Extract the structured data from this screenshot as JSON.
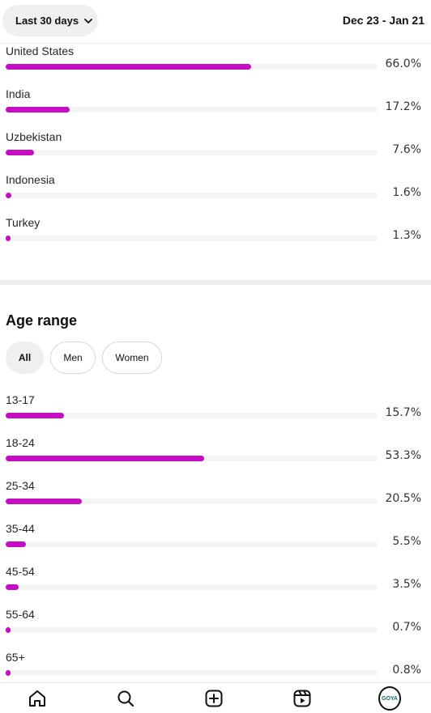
{
  "header": {
    "range_label": "Last 30 days",
    "date_range": "Dec 23 - Jan 21"
  },
  "countries": [
    {
      "name": "United States",
      "percent_label": "66.0%",
      "percent": 66.0
    },
    {
      "name": "India",
      "percent_label": "17.2%",
      "percent": 17.2
    },
    {
      "name": "Uzbekistan",
      "percent_label": "7.6%",
      "percent": 7.6
    },
    {
      "name": "Indonesia",
      "percent_label": "1.6%",
      "percent": 1.6
    },
    {
      "name": "Turkey",
      "percent_label": "1.3%",
      "percent": 1.3
    }
  ],
  "age_section": {
    "title": "Age range",
    "filters": [
      "All",
      "Men",
      "Women"
    ],
    "selected_filter": "All",
    "ranges": [
      {
        "name": "13-17",
        "percent_label": "15.7%",
        "percent": 15.7
      },
      {
        "name": "18-24",
        "percent_label": "53.3%",
        "percent": 53.3
      },
      {
        "name": "25-34",
        "percent_label": "20.5%",
        "percent": 20.5
      },
      {
        "name": "35-44",
        "percent_label": "5.5%",
        "percent": 5.5
      },
      {
        "name": "45-54",
        "percent_label": "3.5%",
        "percent": 3.5
      },
      {
        "name": "55-64",
        "percent_label": "0.7%",
        "percent": 0.7
      },
      {
        "name": "65+",
        "percent_label": "0.8%",
        "percent": 0.8
      }
    ]
  },
  "bottom_nav": {
    "items": [
      "home-icon",
      "search-icon",
      "create-icon",
      "reels-icon",
      "profile-avatar"
    ],
    "avatar_text": "GOYA"
  },
  "colors": {
    "bar_fill": "#c60dc3",
    "bar_track": "#f4f4f4",
    "chip_active_bg": "#efefef"
  }
}
